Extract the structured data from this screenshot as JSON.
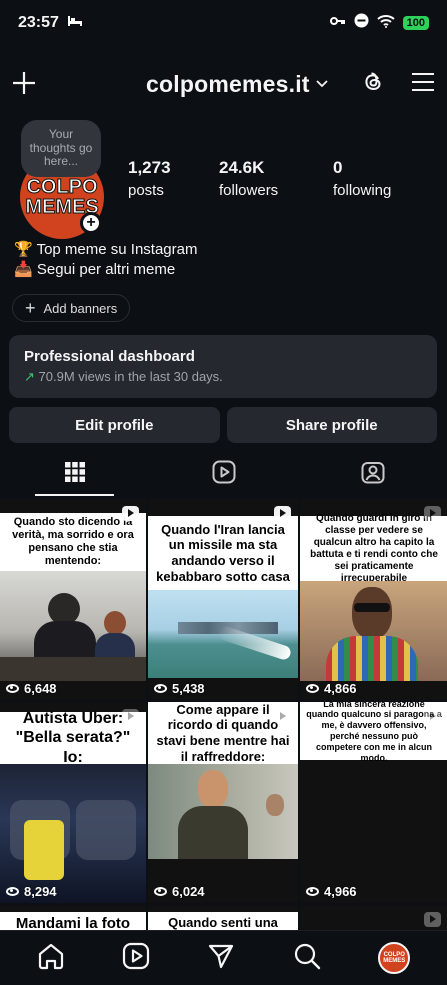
{
  "status_bar": {
    "time": "23:57",
    "battery": "100"
  },
  "header": {
    "username": "colpomemes.it"
  },
  "profile": {
    "thought_bubble": "Your thoughts go here...",
    "avatar_text_line1": "COLPO",
    "avatar_text_line2": "MEMES",
    "stats": [
      {
        "value": "1,273",
        "label": "posts"
      },
      {
        "value": "24.6K",
        "label": "followers"
      },
      {
        "value": "0",
        "label": "following"
      }
    ],
    "bio": [
      "🏆 Top meme su Instagram",
      "📥 Segui per altri meme"
    ],
    "add_banners": "Add banners"
  },
  "dashboard": {
    "title": "Professional dashboard",
    "arrow": "↗",
    "subtitle": "70.9M views in the last 30 days."
  },
  "buttons": {
    "edit": "Edit profile",
    "share": "Share profile"
  },
  "tabs": [
    {
      "icon": "grid-icon",
      "active": true
    },
    {
      "icon": "reels-icon",
      "active": false
    },
    {
      "icon": "tagged-icon",
      "active": false
    }
  ],
  "posts": [
    {
      "caption": "Quando sto dicendo la verità, ma sorrido e ora pensano che stia mentendo:",
      "views": "6,648"
    },
    {
      "caption": "Quando l'Iran lancia un missile ma sta andando verso il kebabbaro sotto casa",
      "views": "5,438"
    },
    {
      "caption": "Quando guardi in giro in classe per vedere se qualcun altro ha capito la battuta e ti rendi conto che sei praticamente irrecuperabile",
      "views": "4,866"
    },
    {
      "caption": "Autista Uber: \"Bella serata?\" Io:",
      "views": "8,294"
    },
    {
      "caption": "Come appare il ricordo di quando stavi bene mentre hai il raffreddore:",
      "views": "6,024"
    },
    {
      "caption": "La mia sincera reazione quando qualcuno si paragona a me, è davvero offensivo, perché nessuno può competere con me in alcun modo.",
      "views": "4,966"
    },
    {
      "caption": "Mandami la foto",
      "views": ""
    },
    {
      "caption": "Quando senti una",
      "views": ""
    }
  ],
  "bottom_nav": [
    {
      "icon": "home-icon"
    },
    {
      "icon": "reels-icon"
    },
    {
      "icon": "send-icon"
    },
    {
      "icon": "search-icon"
    },
    {
      "icon": "profile-avatar"
    }
  ],
  "colors": {
    "background": "#0c0f14",
    "card": "#25292f",
    "accent_green": "#3ec46d",
    "avatar_orange": "#d1431f"
  }
}
